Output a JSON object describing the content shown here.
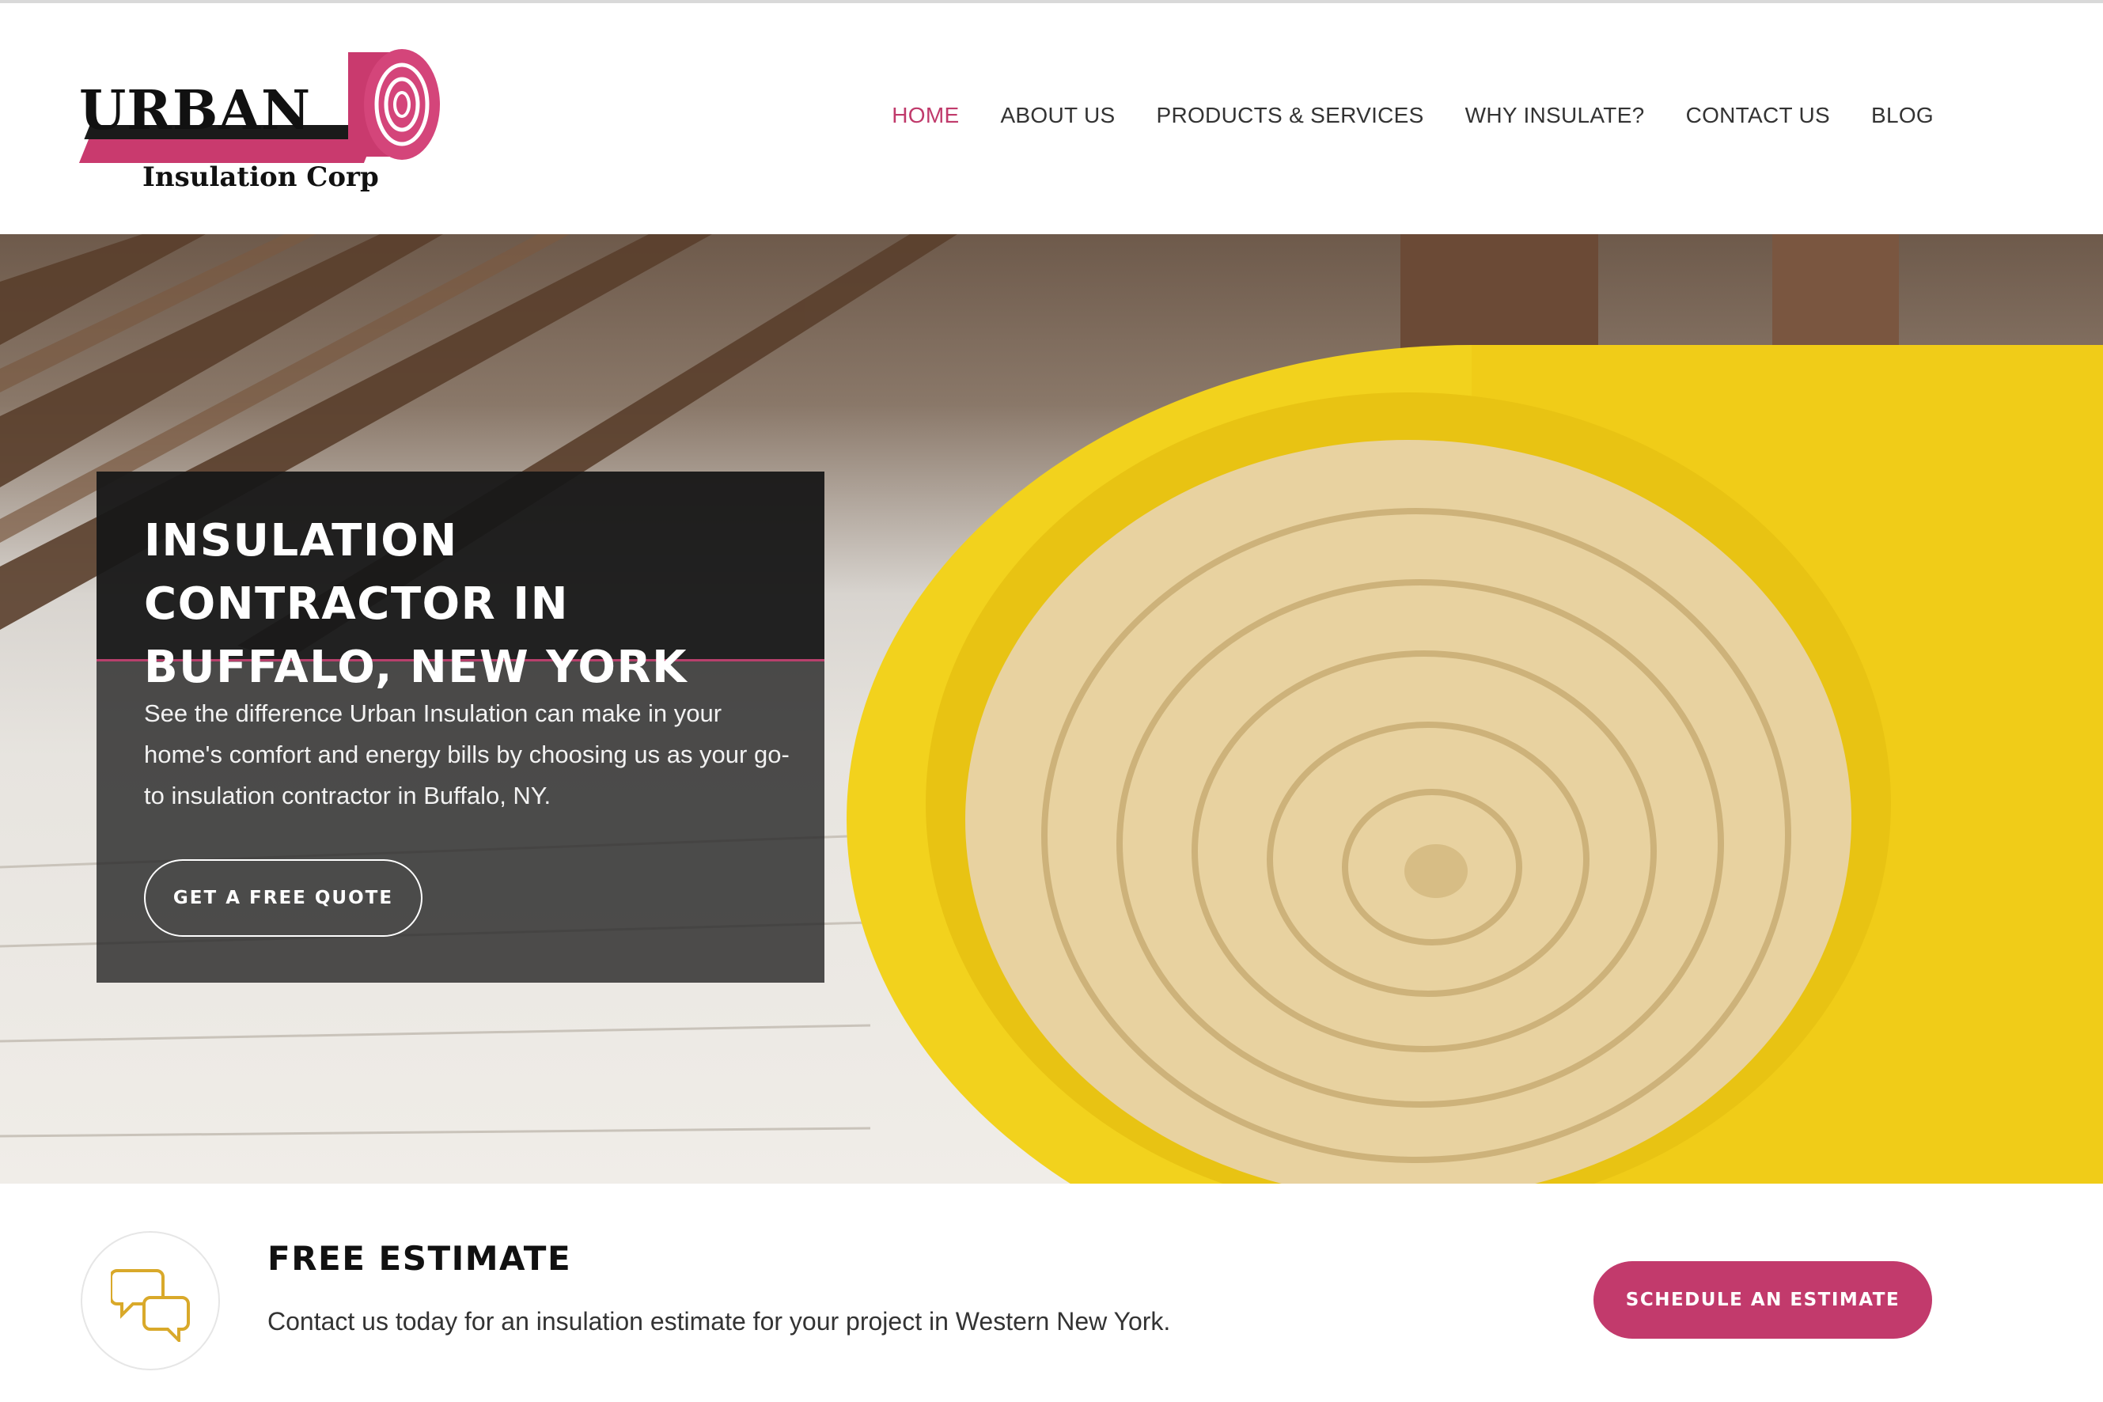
{
  "brand": {
    "logo_word": "URBAN",
    "logo_sub": "Insulation Corp",
    "accent_color": "#c23a6c"
  },
  "nav": {
    "items": [
      {
        "label": "HOME",
        "active": true
      },
      {
        "label": "ABOUT US",
        "active": false
      },
      {
        "label": "PRODUCTS & SERVICES",
        "active": false
      },
      {
        "label": "WHY INSULATE?",
        "active": false
      },
      {
        "label": "CONTACT US",
        "active": false
      },
      {
        "label": "BLOG",
        "active": false
      }
    ]
  },
  "hero": {
    "title": "INSULATION CONTRACTOR IN BUFFALO, NEW YORK",
    "text": "See the difference Urban Insulation can make in your home's comfort and energy bills by choosing us as your go-to insulation contractor in Buffalo, NY.",
    "cta_label": "GET A FREE QUOTE",
    "image_icon": "insulation-roll-photo"
  },
  "estimate": {
    "icon": "chat-bubbles-icon",
    "title": "FREE ESTIMATE",
    "text": "Contact us today for an insulation estimate for your project in Western New York.",
    "cta_label": "SCHEDULE AN ESTIMATE"
  }
}
